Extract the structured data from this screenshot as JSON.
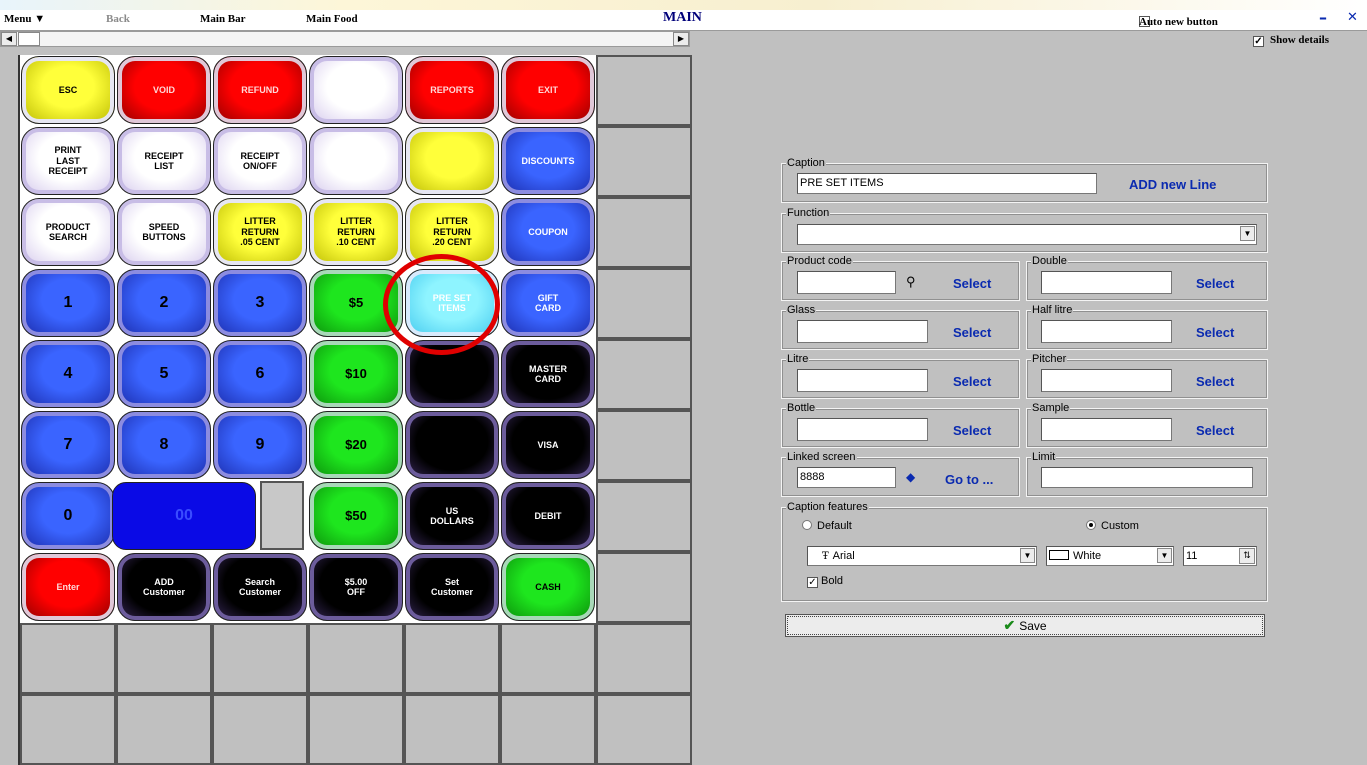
{
  "menubar": {
    "menu": "Menu ▼",
    "back": "Back",
    "main_bar": "Main Bar",
    "main_food": "Main Food",
    "title": "MAIN",
    "auto_new_button": "Auto new button",
    "show_details": "Show details",
    "minimize": "–",
    "close": "✕"
  },
  "buttons": [
    {
      "label": "ESC",
      "color": "yellow"
    },
    {
      "label": "VOID",
      "color": "red"
    },
    {
      "label": "REFUND",
      "color": "red"
    },
    {
      "label": "",
      "color": "white"
    },
    {
      "label": "REPORTS",
      "color": "red"
    },
    {
      "label": "EXIT",
      "color": "red"
    },
    {
      "label": "PRINT\nLAST\nRECEIPT",
      "color": "white"
    },
    {
      "label": "RECEIPT\nLIST",
      "color": "white"
    },
    {
      "label": "RECEIPT\nON/OFF",
      "color": "white"
    },
    {
      "label": "",
      "color": "white"
    },
    {
      "label": "",
      "color": "yellow"
    },
    {
      "label": "DISCOUNTS",
      "color": "blue"
    },
    {
      "label": "PRODUCT\nSEARCH",
      "color": "white"
    },
    {
      "label": "SPEED\nBUTTONS",
      "color": "white"
    },
    {
      "label": "LITTER\nRETURN\n.05 CENT",
      "color": "yellow"
    },
    {
      "label": "LITTER\nRETURN\n.10 CENT",
      "color": "yellow"
    },
    {
      "label": "LITTER\nRETURN\n.20 CENT",
      "color": "yellow"
    },
    {
      "label": "COUPON",
      "color": "blue"
    },
    {
      "label": "1",
      "color": "blue"
    },
    {
      "label": "2",
      "color": "blue"
    },
    {
      "label": "3",
      "color": "blue"
    },
    {
      "label": "$5",
      "color": "green"
    },
    {
      "label": "PRE SET\nITEMS",
      "color": "cyan"
    },
    {
      "label": "GIFT\nCARD",
      "color": "blue"
    },
    {
      "label": "4",
      "color": "blue"
    },
    {
      "label": "5",
      "color": "blue"
    },
    {
      "label": "6",
      "color": "blue"
    },
    {
      "label": "$10",
      "color": "green"
    },
    {
      "label": "",
      "color": "black"
    },
    {
      "label": "MASTER\nCARD",
      "color": "black"
    },
    {
      "label": "7",
      "color": "blue"
    },
    {
      "label": "8",
      "color": "blue"
    },
    {
      "label": "9",
      "color": "blue"
    },
    {
      "label": "$20",
      "color": "green"
    },
    {
      "label": "",
      "color": "black"
    },
    {
      "label": "VISA",
      "color": "black"
    },
    {
      "label": "0",
      "color": "blue"
    },
    {
      "label": "00",
      "color": "bluewide"
    },
    {
      "label": "",
      "color": "gray"
    },
    {
      "label": "$50",
      "color": "green"
    },
    {
      "label": "US\nDOLLARS",
      "color": "black"
    },
    {
      "label": "DEBIT",
      "color": "black"
    },
    {
      "label": "Enter",
      "color": "red"
    },
    {
      "label": "ADD\nCustomer",
      "color": "black"
    },
    {
      "label": "Search\nCustomer",
      "color": "black"
    },
    {
      "label": "$5.00\nOFF",
      "color": "black"
    },
    {
      "label": "Set\nCustomer",
      "color": "black"
    },
    {
      "label": "CASH",
      "color": "green"
    }
  ],
  "form": {
    "caption_label": "Caption",
    "caption_value": "PRE SET ITEMS",
    "add_new_line": "ADD new Line",
    "function_label": "Function",
    "function_value": "",
    "product_code_label": "Product code",
    "double_label": "Double",
    "glass_label": "Glass",
    "half_litre_label": "Half litre",
    "litre_label": "Litre",
    "pitcher_label": "Pitcher",
    "bottle_label": "Bottle",
    "sample_label": "Sample",
    "select": "Select",
    "linked_screen_label": "Linked screen",
    "linked_screen_value": "8888",
    "go_to": "Go to ...",
    "limit_label": "Limit",
    "caption_features_label": "Caption features",
    "default_option": "Default",
    "custom_option": "Custom",
    "font_value": "Arial",
    "color_value": "White",
    "size_value": "11",
    "bold_label": "Bold",
    "save": "Save"
  },
  "colors": {
    "accent": "#0a2ab0",
    "highlight_ring": "#e00000"
  }
}
